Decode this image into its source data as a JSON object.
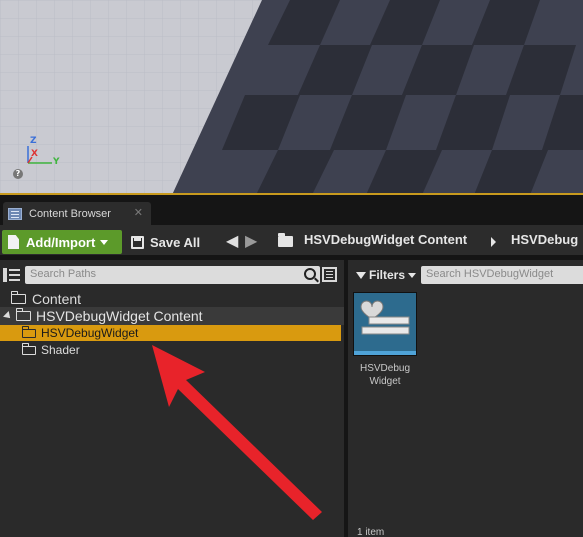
{
  "viewport": {
    "axis_z": "Z",
    "axis_x": "X",
    "axis_y": "Y",
    "help_glyph": "?"
  },
  "tab": {
    "icon": "content-browser-icon",
    "label": "Content Browser",
    "close_glyph": "✕"
  },
  "toolbar": {
    "add_import_label": "Add/Import",
    "save_all_label": "Save All",
    "back_glyph": "🡐",
    "forward_glyph": "🡒",
    "breadcrumb": [
      "HSVDebugWidget Content",
      "HSVDebug"
    ]
  },
  "sources": {
    "search_placeholder": "Search Paths",
    "tree": [
      {
        "label": "Content",
        "level": 0
      },
      {
        "label": "HSVDebugWidget Content",
        "level": 0,
        "expanded": true
      },
      {
        "label": "HSVDebugWidget",
        "level": 1,
        "selected": true
      },
      {
        "label": "Shader",
        "level": 1
      }
    ]
  },
  "assets": {
    "filters_label": "Filters",
    "search_placeholder": "Search HSVDebugWidget",
    "items": [
      {
        "name_line1": "HSVDebug",
        "name_line2": "Widget",
        "icon": "widget-blueprint-icon"
      }
    ],
    "count_label": "1 item"
  },
  "colors": {
    "accent_selection": "#d99a0f",
    "add_button": "#5c9a2a",
    "annotation_arrow": "#e8232a",
    "viewport_border": "#c89a1e"
  }
}
